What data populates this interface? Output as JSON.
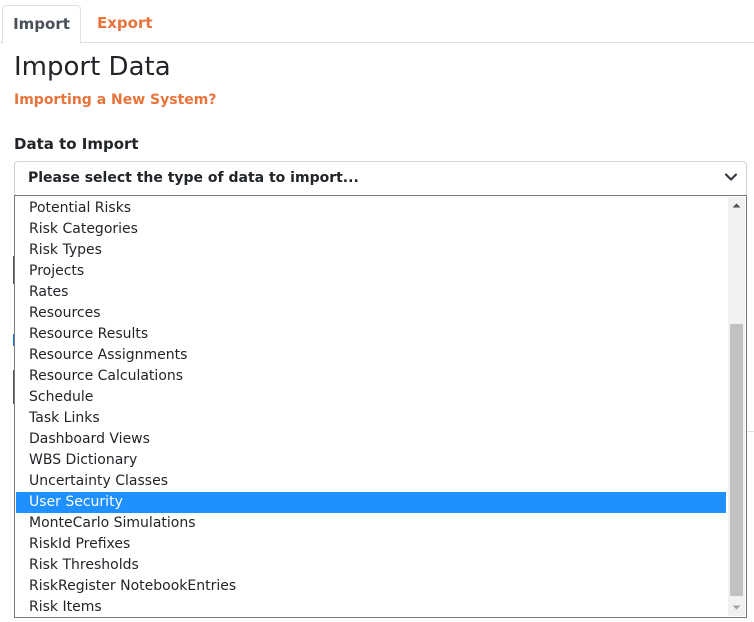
{
  "tabs": [
    {
      "label": "Import",
      "active": true
    },
    {
      "label": "Export",
      "active": false
    }
  ],
  "page": {
    "title": "Import Data",
    "subtitle_link": "Importing a New System?"
  },
  "form": {
    "data_label": "Data to Import",
    "select_value": "Please select the type of data to import..."
  },
  "dropdown": {
    "options": [
      "Potential Risks",
      "Risk Categories",
      "Risk Types",
      "Projects",
      "Rates",
      "Resources",
      "Resource Results",
      "Resource Assignments",
      "Resource Calculations",
      "Schedule",
      "Task Links",
      "Dashboard Views",
      "WBS Dictionary",
      "Uncertainty Classes",
      "User Security",
      "MonteCarlo Simulations",
      "RiskId Prefixes",
      "Risk Thresholds",
      "RiskRegister NotebookEntries",
      "Risk Items"
    ],
    "highlighted": "User Security"
  },
  "colors": {
    "accent": "#e8743b",
    "selection": "#1e90ff"
  }
}
